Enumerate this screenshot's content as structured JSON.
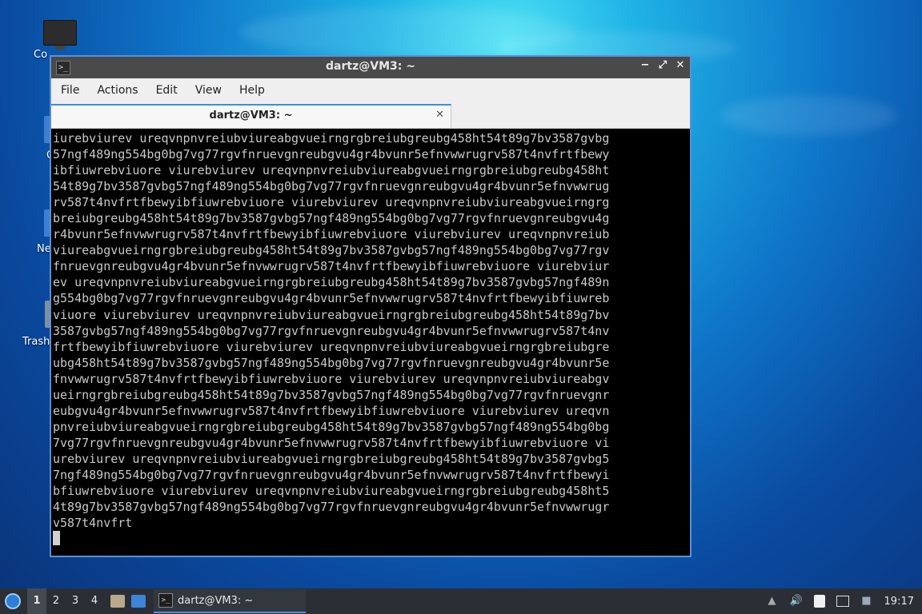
{
  "desktop": {
    "icons": [
      {
        "label": "Co"
      },
      {
        "label": "C"
      },
      {
        "label": "Ne"
      },
      {
        "label": "Trash"
      }
    ]
  },
  "window": {
    "title": "dartz@VM3: ~",
    "icon_name": "terminal-icon",
    "controls": {
      "minimize": "−",
      "maximize": "⤢",
      "close": "✕"
    },
    "menu": [
      "File",
      "Actions",
      "Edit",
      "View",
      "Help"
    ],
    "tab": {
      "label": "dartz@VM3: ~",
      "close": "✕"
    },
    "terminal_lines": [
      "iurebviurev ureqvnpnvreiubviureabgvueirngrgbreiubgreubg458ht54t89g7bv3587gvbg",
      "57ngf489ng554bg0bg7vg77rgvfnruevgnreubgvu4gr4bvunr5efnvwwrugrv587t4nvfrtfbewy",
      "ibfiuwrebviuore viurebviurev ureqvnpnvreiubviureabgvueirngrgbreiubgreubg458ht",
      "54t89g7bv3587gvbg57ngf489ng554bg0bg7vg77rgvfnruevgnreubgvu4gr4bvunr5efnvwwrug",
      "rv587t4nvfrtfbewyibfiuwrebviuore viurebviurev ureqvnpnvreiubviureabgvueirngrg",
      "breiubgreubg458ht54t89g7bv3587gvbg57ngf489ng554bg0bg7vg77rgvfnruevgnreubgvu4g",
      "r4bvunr5efnvwwrugrv587t4nvfrtfbewyibfiuwrebviuore viurebviurev ureqvnpnvreiub",
      "viureabgvueirngrgbreiubgreubg458ht54t89g7bv3587gvbg57ngf489ng554bg0bg7vg77rgv",
      "fnruevgnreubgvu4gr4bvunr5efnvwwrugrv587t4nvfrtfbewyibfiuwrebviuore viurebviur",
      "ev ureqvnpnvreiubviureabgvueirngrgbreiubgreubg458ht54t89g7bv3587gvbg57ngf489n",
      "g554bg0bg7vg77rgvfnruevgnreubgvu4gr4bvunr5efnvwwrugrv587t4nvfrtfbewyibfiuwreb",
      "viuore viurebviurev ureqvnpnvreiubviureabgvueirngrgbreiubgreubg458ht54t89g7bv",
      "3587gvbg57ngf489ng554bg0bg7vg77rgvfnruevgnreubgvu4gr4bvunr5efnvwwrugrv587t4nv",
      "frtfbewyibfiuwrebviuore viurebviurev ureqvnpnvreiubviureabgvueirngrgbreiubgre",
      "ubg458ht54t89g7bv3587gvbg57ngf489ng554bg0bg7vg77rgvfnruevgnreubgvu4gr4bvunr5e",
      "fnvwwrugrv587t4nvfrtfbewyibfiuwrebviuore viurebviurev ureqvnpnvreiubviureabgv",
      "ueirngrgbreiubgreubg458ht54t89g7bv3587gvbg57ngf489ng554bg0bg7vg77rgvfnruevgnr",
      "eubgvu4gr4bvunr5efnvwwrugrv587t4nvfrtfbewyibfiuwrebviuore viurebviurev ureqvn",
      "pnvreiubviureabgvueirngrgbreiubgreubg458ht54t89g7bv3587gvbg57ngf489ng554bg0bg",
      "7vg77rgvfnruevgnreubgvu4gr4bvunr5efnvwwrugrv587t4nvfrtfbewyibfiuwrebviuore vi",
      "urebviurev ureqvnpnvreiubviureabgvueirngrgbreiubgreubg458ht54t89g7bv3587gvbg5",
      "7ngf489ng554bg0bg7vg77rgvfnruevgnreubgvu4gr4bvunr5efnvwwrugrv587t4nvfrtfbewyi",
      "bfiuwrebviuore viurebviurev ureqvnpnvreiubviureabgvueirngrgbreiubgreubg458ht5",
      "4t89g7bv3587gvbg57ngf489ng554bg0bg7vg77rgvfnruevgnreubgvu4gr4bvunr5efnvwwrugr",
      "v587t4nvfrt"
    ]
  },
  "taskbar": {
    "workspaces": [
      "1",
      "2",
      "3",
      "4"
    ],
    "active_workspace": "1",
    "task_label": "dartz@VM3: ~",
    "clock": "19:17",
    "tray_icons": [
      "up-arrow-icon",
      "volume-icon",
      "clipboard-icon",
      "network-icon",
      "notification-icon"
    ]
  },
  "colors": {
    "accent": "#4e8ee0",
    "terminal_bg": "#000000",
    "terminal_fg": "#c8c8c8",
    "taskbar_bg": "#2b2f35"
  }
}
